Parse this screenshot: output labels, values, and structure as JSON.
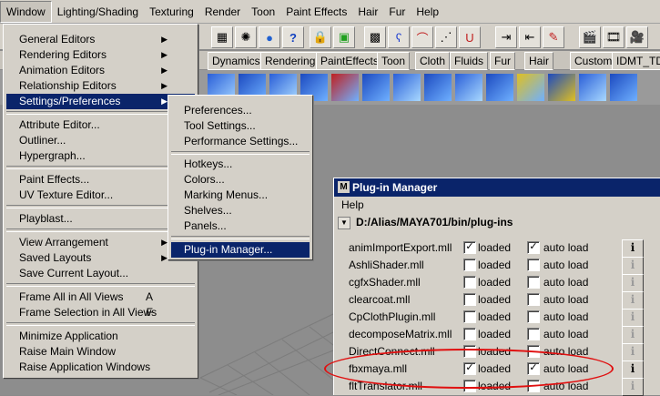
{
  "menubar": {
    "items": [
      "Window",
      "Lighting/Shading",
      "Texturing",
      "Render",
      "Toon",
      "Paint Effects",
      "Hair",
      "Fur",
      "Help"
    ]
  },
  "shelf_tabs": [
    "Dynamics",
    "Rendering",
    "PaintEffects",
    "Toon",
    "Cloth",
    "Fluids",
    "Fur",
    "Hair",
    "Custom",
    "IDMT_TD"
  ],
  "window_menu": {
    "groups": [
      [
        {
          "label": "General Editors",
          "submenu": true
        },
        {
          "label": "Rendering Editors",
          "submenu": true
        },
        {
          "label": "Animation Editors",
          "submenu": true
        },
        {
          "label": "Relationship Editors",
          "submenu": true
        },
        {
          "label": "Settings/Preferences",
          "submenu": true,
          "selected": true
        }
      ],
      [
        {
          "label": "Attribute Editor..."
        },
        {
          "label": "Outliner..."
        },
        {
          "label": "Hypergraph..."
        }
      ],
      [
        {
          "label": "Paint Effects..."
        },
        {
          "label": "UV Texture Editor..."
        }
      ],
      [
        {
          "label": "Playblast..."
        }
      ],
      [
        {
          "label": "View Arrangement",
          "submenu": true
        },
        {
          "label": "Saved Layouts",
          "submenu": true
        },
        {
          "label": "Save Current Layout..."
        }
      ],
      [
        {
          "label": "Frame All in All Views",
          "shortcut": "A"
        },
        {
          "label": "Frame Selection in All Views",
          "shortcut": "F"
        }
      ],
      [
        {
          "label": "Minimize Application"
        },
        {
          "label": "Raise Main Window"
        },
        {
          "label": "Raise Application Windows"
        }
      ]
    ]
  },
  "settings_submenu": {
    "groups": [
      [
        {
          "label": "Preferences..."
        },
        {
          "label": "Tool Settings..."
        },
        {
          "label": "Performance Settings..."
        }
      ],
      [
        {
          "label": "Hotkeys..."
        },
        {
          "label": "Colors..."
        },
        {
          "label": "Marking Menus..."
        },
        {
          "label": "Shelves..."
        },
        {
          "label": "Panels..."
        }
      ],
      [
        {
          "label": "Plug-in Manager...",
          "selected": true
        }
      ]
    ]
  },
  "plugin_manager": {
    "title": "Plug-in Manager",
    "menu_help": "Help",
    "path": "D:/Alias/MAYA701/bin/plug-ins",
    "loaded_label": "loaded",
    "autoload_label": "auto load",
    "info_glyph": "i",
    "plugins": [
      {
        "name": "animImportExport.mll",
        "loaded": true,
        "auto_load": true
      },
      {
        "name": "AshliShader.mll",
        "loaded": false,
        "auto_load": false
      },
      {
        "name": "cgfxShader.mll",
        "loaded": false,
        "auto_load": false
      },
      {
        "name": "clearcoat.mll",
        "loaded": false,
        "auto_load": false
      },
      {
        "name": "CpClothPlugin.mll",
        "loaded": false,
        "auto_load": false
      },
      {
        "name": "decomposeMatrix.mll",
        "loaded": false,
        "auto_load": false
      },
      {
        "name": "DirectConnect.mll",
        "loaded": false,
        "auto_load": false
      },
      {
        "name": "fbxmaya.mll",
        "loaded": true,
        "auto_load": true
      },
      {
        "name": "fltTranslator.mll",
        "loaded": false,
        "auto_load": false
      }
    ]
  },
  "colors": {
    "menu_bg": "#d4d0c8",
    "selection": "#0a246a",
    "title_bar": "#0a246a",
    "highlight_ellipse": "#e01010"
  }
}
